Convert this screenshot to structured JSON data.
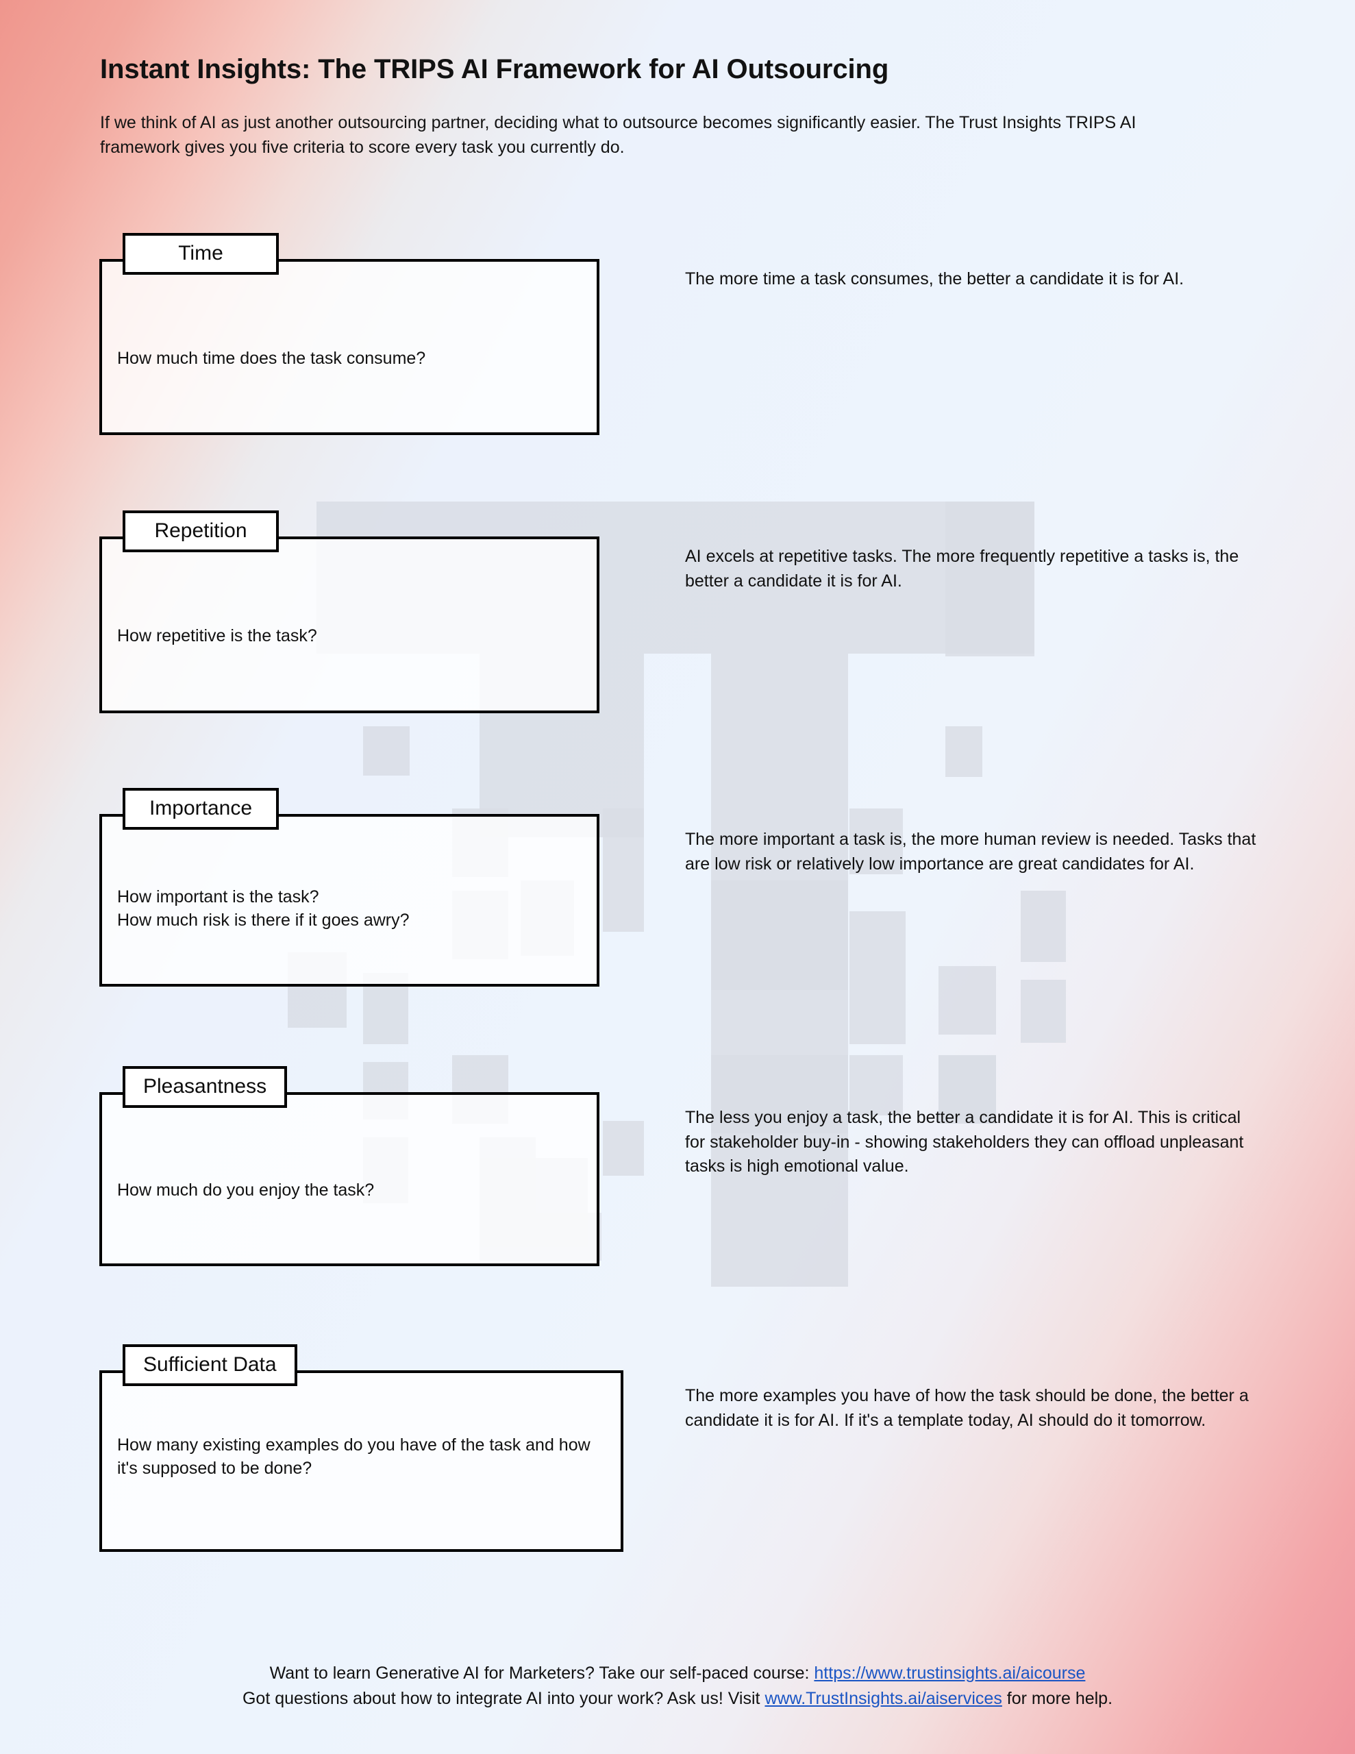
{
  "document": {
    "title": "Instant Insights: The TRIPS AI Framework for AI Outsourcing",
    "intro": "If we think of AI as just another outsourcing partner, deciding what to outsource becomes significantly easier. The Trust Insights TRIPS AI framework gives you five criteria to score every task you currently do."
  },
  "theme": {
    "background_top_left": "#ef968d",
    "background_center": "#edf4fd",
    "background_bottom_right": "#f0939c",
    "card_border": "#000000",
    "card_fill": "#ffffff",
    "watermark_gray": "#d9dde5",
    "link_color": "#1a55c4",
    "text_color": "#111111"
  },
  "criteria": [
    {
      "label": "Time",
      "question": "How much time does the task consume?",
      "description": "The more time a task consumes, the better a candidate it is for AI."
    },
    {
      "label": "Repetition",
      "question": "How repetitive is the task?",
      "description": "AI excels at repetitive tasks. The more frequently repetitive a tasks is, the better a candidate it is for AI."
    },
    {
      "label": "Importance",
      "question": "How important is the task?\nHow much risk is there if it goes awry?",
      "description": "The more important a task is, the more human review is needed. Tasks that are low risk or relatively low importance are great candidates for AI."
    },
    {
      "label": "Pleasantness",
      "question": "How much do you enjoy the task?",
      "description": "The less you enjoy a task, the better a candidate it is for AI. This is critical for stakeholder buy-in - showing stakeholders they can offload unpleasant tasks is high emotional value."
    },
    {
      "label": "Sufficient Data",
      "question": "How many existing examples do you have of the task and how it's supposed to be done?",
      "description": "The more examples you have of how the task should be done, the better a candidate it is for AI. If it's a template today, AI should do it tomorrow."
    }
  ],
  "footer": {
    "line1_prefix": "Want to learn Generative AI for Marketers? Take our self-paced course: ",
    "line1_link": "https://www.trustinsights.ai/aicourse",
    "line2_prefix": "Got questions about how to integrate AI into your work? Ask us! Visit ",
    "line2_link": "www.TrustInsights.ai/aiservices",
    "line2_suffix": " for more help."
  }
}
